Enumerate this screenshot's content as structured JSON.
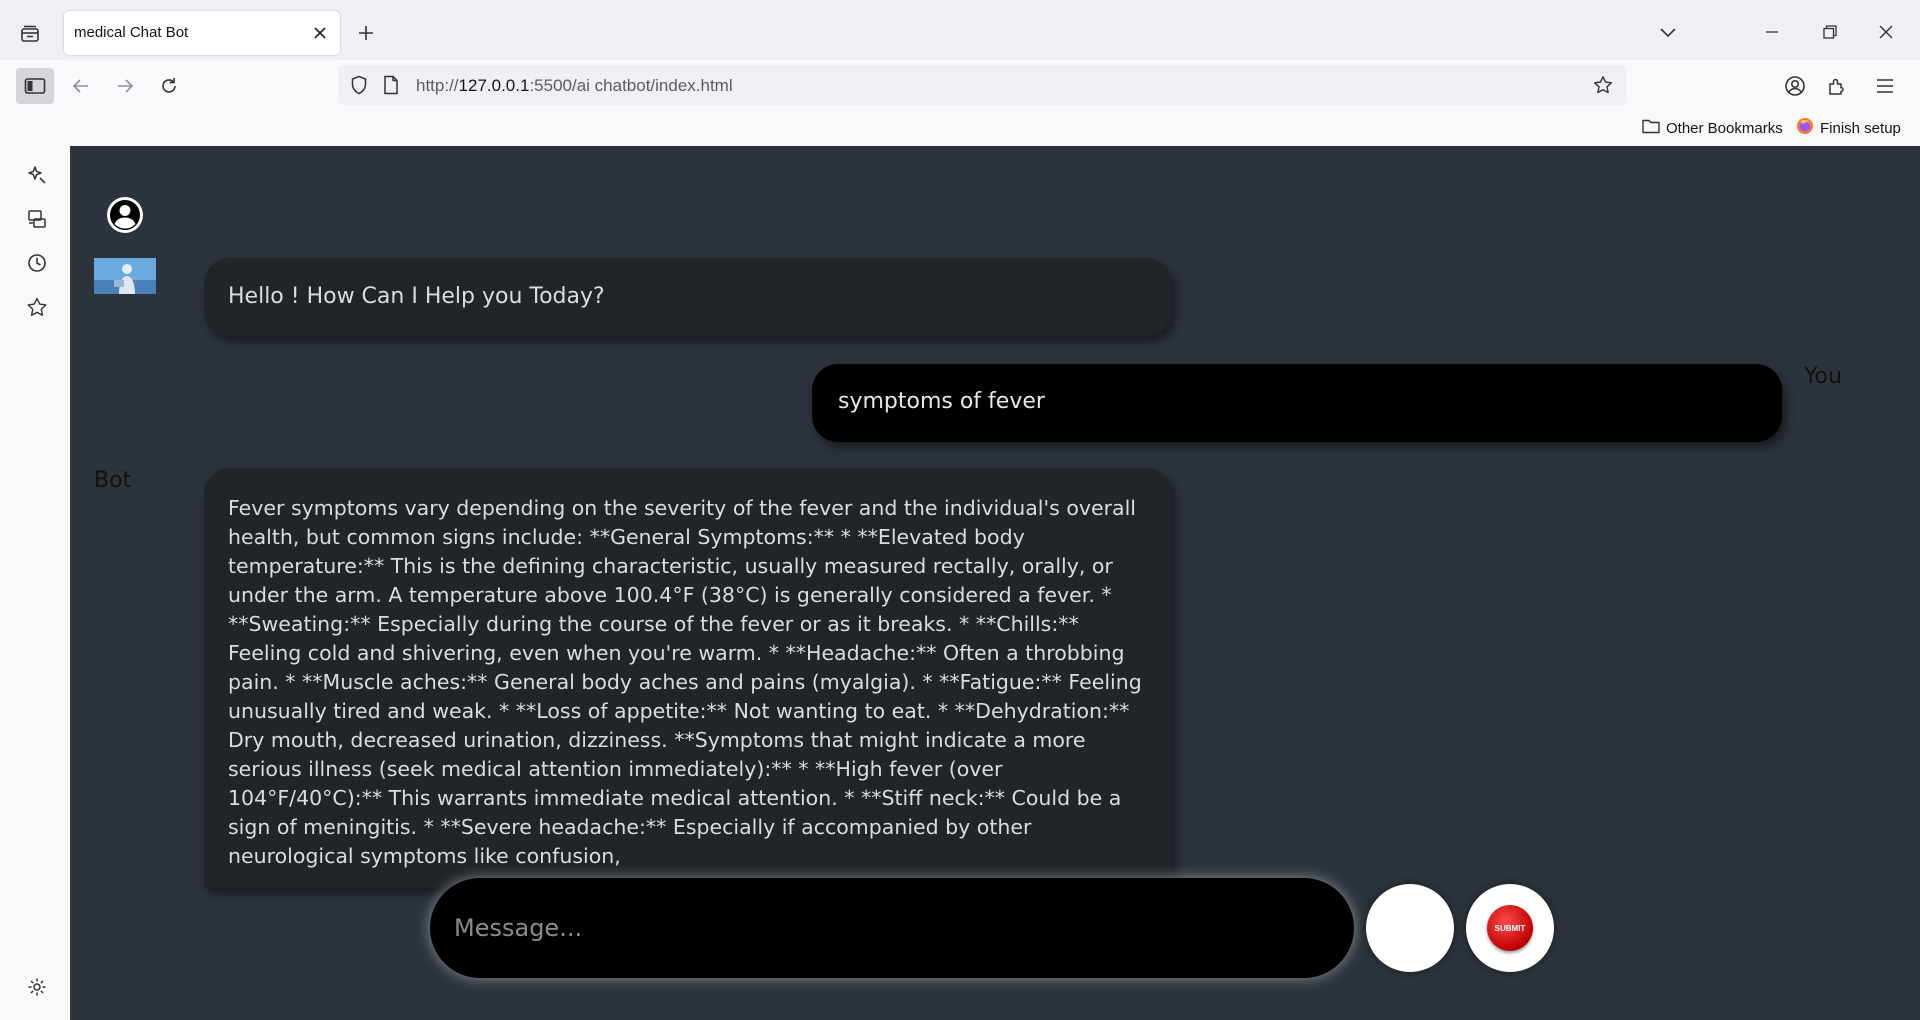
{
  "browser": {
    "tab": {
      "title": "medical Chat Bot"
    },
    "url": {
      "scheme": "http://",
      "host": "127.0.0.1",
      "rest": ":5500/ai chatbot/index.html"
    },
    "bookmarks": [
      {
        "label": "Other Bookmarks",
        "icon": "folder-icon"
      },
      {
        "label": "Finish setup",
        "icon": "firefox-icon"
      }
    ],
    "icons": {
      "tabs": "tab-list-icon",
      "close": "close-icon",
      "new_tab": "plus-icon",
      "list_all": "chevron-down-icon",
      "minimize": "minimize-icon",
      "restore": "restore-icon",
      "window_close": "close-icon",
      "sidebar": "sidebar-icon",
      "back": "back-arrow-icon",
      "forward": "forward-arrow-icon",
      "reload": "reload-icon",
      "shield": "shield-icon",
      "page": "page-icon",
      "star": "star-icon",
      "account": "account-icon",
      "extensions": "extensions-icon",
      "menu": "hamburger-menu-icon"
    },
    "sidebar_icons": [
      "ai-sparkle-icon",
      "synced-tabs-icon",
      "history-icon",
      "bookmarks-star-icon",
      "settings-gear-icon"
    ]
  },
  "chat": {
    "greeting": "Hello ! How Can I Help you Today?",
    "user_label": "You",
    "user_message": "symptoms of fever",
    "bot_label": "Bot",
    "bot_message": "Fever symptoms vary depending on the severity of the fever and the individual's overall health, but common signs include: **General Symptoms:** * **Elevated body temperature:** This is the defining characteristic, usually measured rectally, orally, or under the arm. A temperature above 100.4°F (38°C) is generally considered a fever. * **Sweating:** Especially during the course of the fever or as it breaks. * **Chills:** Feeling cold and shivering, even when you're warm. * **Headache:** Often a throbbing pain. * **Muscle aches:** General body aches and pains (myalgia). * **Fatigue:** Feeling unusually tired and weak. * **Loss of appetite:** Not wanting to eat. * **Dehydration:** Dry mouth, decreased urination, dizziness. **Symptoms that might indicate a more serious illness (seek medical attention immediately):** * **High fever (over 104°F/40°C):** This warrants immediate medical attention. * **Stiff neck:** Could be a sign of meningitis. * **Severe headache:** Especially if accompanied by other neurological symptoms like confusion,",
    "input_placeholder": "Message...",
    "submit_label": "SUBMIT"
  },
  "colors": {
    "page_bg": "#2c333b",
    "bot_bubble": "#212429",
    "user_bubble": "#000000",
    "submit": "#d10000"
  }
}
